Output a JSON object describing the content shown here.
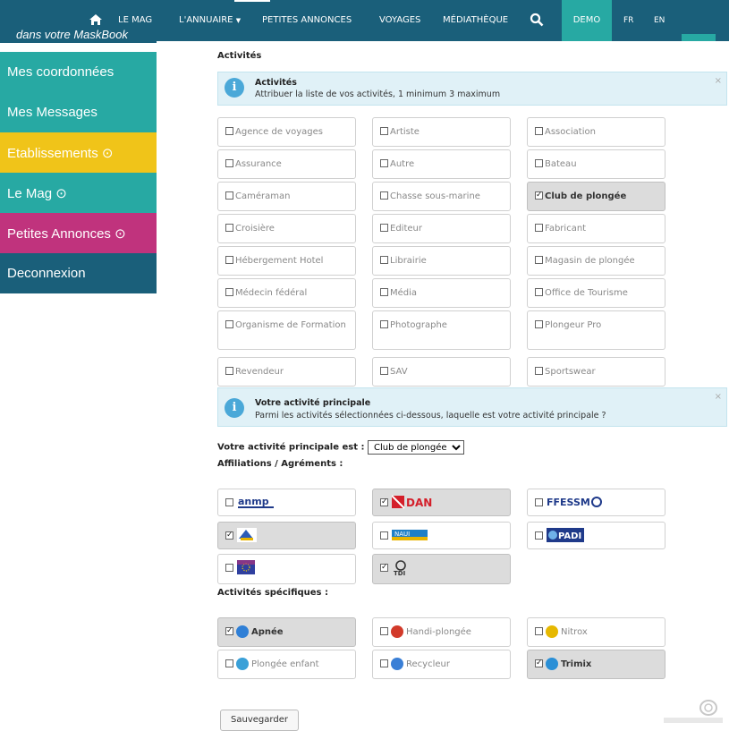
{
  "nav": {
    "lemag": "LE MAG",
    "annuaire": "L'ANNUAIRE",
    "annonces": "PETITES ANNONCES",
    "voyages": "VOYAGES",
    "media": "MÉDIATHÈQUE",
    "demo": "DEMO",
    "fr": "FR",
    "en": "EN",
    "bg_color": "#1a5f7a",
    "accent_color": "#27a9a3",
    "icons": [
      "home-icon",
      "caret-down-icon",
      "search-icon"
    ]
  },
  "sidebar": {
    "tagline": "dans votre MaskBook",
    "items": [
      {
        "label": "Mes coordonnées",
        "color": "#27a9a3"
      },
      {
        "label": "Mes Messages",
        "color": "#27a9a3"
      },
      {
        "label": "Etablissements ⊙",
        "color": "#f0c419"
      },
      {
        "label": "Le Mag ⊙",
        "color": "#27a9a3"
      },
      {
        "label": "Petites Annonces ⊙",
        "color": "#c0337d"
      },
      {
        "label": "Deconnexion",
        "color": "#1a5f7a"
      }
    ]
  },
  "activites": {
    "title": "Activités",
    "alert": {
      "title": "Activités",
      "text": "Attribuer la liste de vos activités, 1 minimum 3 maximum",
      "close": "×"
    },
    "options": [
      {
        "label": "Agence de voyages",
        "checked": false
      },
      {
        "label": "Artiste",
        "checked": false
      },
      {
        "label": "Association",
        "checked": false
      },
      {
        "label": "Assurance",
        "checked": false
      },
      {
        "label": "Autre",
        "checked": false
      },
      {
        "label": "Bateau",
        "checked": false
      },
      {
        "label": "Caméraman",
        "checked": false
      },
      {
        "label": "Chasse sous-marine",
        "checked": false
      },
      {
        "label": "Club de plongée",
        "checked": true
      },
      {
        "label": "Croisière",
        "checked": false
      },
      {
        "label": "Editeur",
        "checked": false
      },
      {
        "label": "Fabricant",
        "checked": false
      },
      {
        "label": "Hébergement Hotel",
        "checked": false
      },
      {
        "label": "Librairie",
        "checked": false
      },
      {
        "label": "Magasin de plongée",
        "checked": false
      },
      {
        "label": "Médecin fédéral",
        "checked": false
      },
      {
        "label": "Média",
        "checked": false
      },
      {
        "label": "Office de Tourisme",
        "checked": false
      },
      {
        "label": "Organisme de Formation",
        "checked": false
      },
      {
        "label": "Photographe",
        "checked": false
      },
      {
        "label": "Plongeur Pro",
        "checked": false
      },
      {
        "label": "Revendeur",
        "checked": false
      },
      {
        "label": "SAV",
        "checked": false
      },
      {
        "label": "Sportswear",
        "checked": false
      }
    ]
  },
  "principale": {
    "alert": {
      "title": "Votre activité principale",
      "text": "Parmi les activités sélectionnées ci-dessous, laquelle est votre activité principale ?",
      "close": "×"
    },
    "label": "Votre activité principale est :",
    "selected": "Club de plongée"
  },
  "affiliations": {
    "title": "Affiliations / Agréments :",
    "items": [
      {
        "logo": "ANMP",
        "checked": false,
        "logo_color": "#1f3a8a"
      },
      {
        "logo": "DAN",
        "checked": true,
        "logo_color": "#d41f2a"
      },
      {
        "logo": "FFESSM",
        "checked": false,
        "logo_color": "#1f3a8a"
      },
      {
        "logo": "NAUI-flag",
        "checked": true,
        "logo_color": "#2b5cb8"
      },
      {
        "logo": "NAUI",
        "checked": false,
        "logo_color": "#1f7fc6"
      },
      {
        "logo": "PADI",
        "checked": false,
        "logo_color": "#1f3a8a"
      },
      {
        "logo": "EU",
        "checked": false,
        "logo_color": "#2f3f9f"
      },
      {
        "logo": "TDI",
        "checked": true,
        "logo_color": "#333333"
      }
    ]
  },
  "specifiques": {
    "title": "Activités spécifiques :",
    "items": [
      {
        "label": "Apnée",
        "checked": true,
        "icon_color": "#2f7fd6"
      },
      {
        "label": "Handi-plongée",
        "checked": false,
        "icon_color": "#d23a2a"
      },
      {
        "label": "Nitrox",
        "checked": false,
        "icon_color": "#e6b800"
      },
      {
        "label": "Plongée enfant",
        "checked": false,
        "icon_color": "#3aa0d8"
      },
      {
        "label": "Recycleur",
        "checked": false,
        "icon_color": "#3a7fd6"
      },
      {
        "label": "Trimix",
        "checked": true,
        "icon_color": "#2a8fd6"
      }
    ]
  },
  "save_label": "Sauvegarder"
}
